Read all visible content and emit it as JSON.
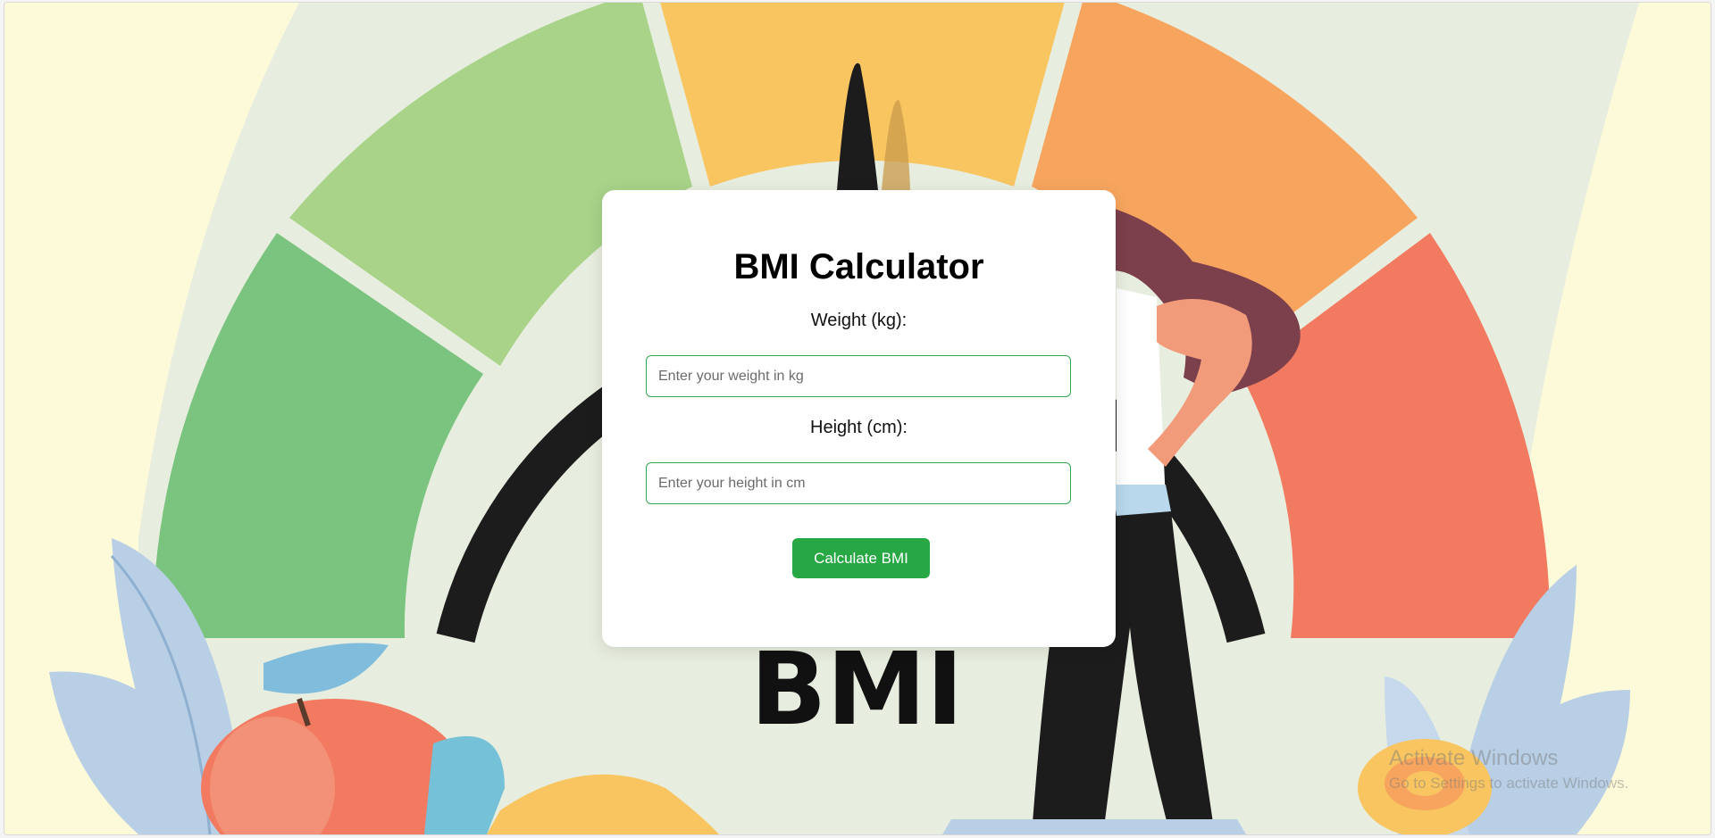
{
  "form": {
    "title": "BMI Calculator",
    "weight_label": "Weight (kg):",
    "weight_placeholder": "Enter your weight in kg",
    "weight_value": "",
    "height_label": "Height (cm):",
    "height_placeholder": "Enter your height in cm",
    "height_value": "",
    "submit_label": "Calculate BMI"
  },
  "background": {
    "badge_text": "BMI"
  },
  "os_watermark": {
    "title": "Activate Windows",
    "subtitle": "Go to Settings to activate Windows."
  },
  "colors": {
    "accent": "#28a745",
    "input_border": "#2fa84f",
    "gauge_segments": [
      "#7bc47f",
      "#a8d389",
      "#f8c561",
      "#f7a55e",
      "#f27a60"
    ],
    "page_bg": "#fdfad9"
  }
}
